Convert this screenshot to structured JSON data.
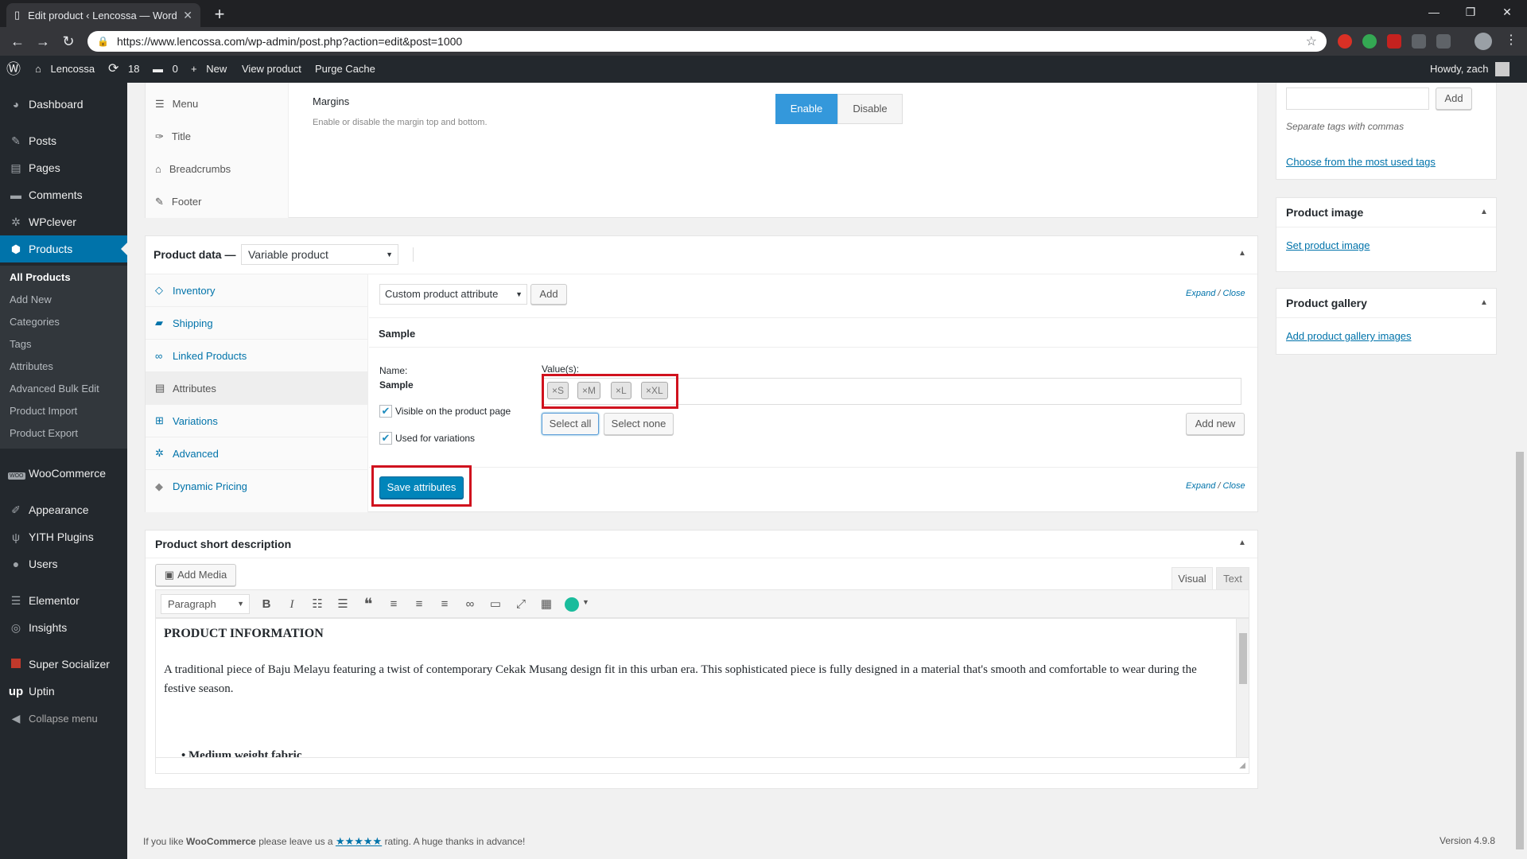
{
  "browser": {
    "tab_title": "Edit product ‹ Lencossa — Word",
    "url": "https://www.lencossa.com/wp-admin/post.php?action=edit&post=1000"
  },
  "adminbar": {
    "site_name": "Lencossa",
    "updates_count": "18",
    "comments_count": "0",
    "new_label": "New",
    "view_product": "View product",
    "purge_cache": "Purge Cache",
    "howdy": "Howdy, zach"
  },
  "sidebar": {
    "items": [
      {
        "label": "Dashboard"
      },
      {
        "label": "Posts"
      },
      {
        "label": "Pages"
      },
      {
        "label": "Comments"
      },
      {
        "label": "WPclever"
      },
      {
        "label": "Products"
      },
      {
        "label": "WooCommerce"
      },
      {
        "label": "Appearance"
      },
      {
        "label": "YITH Plugins"
      },
      {
        "label": "Users"
      },
      {
        "label": "Elementor"
      },
      {
        "label": "Insights"
      },
      {
        "label": "Super Socializer"
      },
      {
        "label": "Uptin"
      },
      {
        "label": "Collapse menu"
      }
    ],
    "submenu": [
      "All Products",
      "Add New",
      "Categories",
      "Tags",
      "Attributes",
      "Advanced Bulk Edit",
      "Product Import",
      "Product Export"
    ],
    "woo_badge": "WOO",
    "uptin_logo": "up"
  },
  "options_panel": {
    "tabs": [
      "Menu",
      "Title",
      "Breadcrumbs",
      "Footer"
    ],
    "margins_title": "Margins",
    "margins_desc": "Enable or disable the margin top and bottom.",
    "enable_label": "Enable",
    "disable_label": "Disable"
  },
  "product_data": {
    "label": "Product data —",
    "type_selected": "Variable product",
    "tabs": [
      "Inventory",
      "Shipping",
      "Linked Products",
      "Attributes",
      "Variations",
      "Advanced",
      "Dynamic Pricing"
    ],
    "attribute_select": "Custom product attribute",
    "add_label": "Add",
    "expand_close": [
      "Expand",
      "/",
      "Close"
    ],
    "attribute_name_heading": "Sample",
    "name_label": "Name:",
    "name_value": "Sample",
    "values_label": "Value(s):",
    "tokens": [
      "S",
      "M",
      "L",
      "XL"
    ],
    "visible_label": "Visible on the product page",
    "variations_label": "Used for variations",
    "select_all": "Select all",
    "select_none": "Select none",
    "add_new": "Add new",
    "save_attributes": "Save attributes"
  },
  "short_desc": {
    "title": "Product short description",
    "add_media": "Add Media",
    "tab_visual": "Visual",
    "tab_text": "Text",
    "format_select": "Paragraph",
    "heading": "PRODUCT INFORMATION",
    "paragraph": "A traditional piece of Baju Melayu featuring a twist of contemporary Cekak Musang design fit in this urban era. This sophisticated piece is fully designed in a material that's smooth and comfortable to wear during the festive season.",
    "cut_bullet": "Medium weight fabric"
  },
  "right_col": {
    "add_label": "Add",
    "tags_hint": "Separate tags with commas",
    "most_used": "Choose from the most used tags",
    "product_image_title": "Product image",
    "set_image": "Set product image",
    "gallery_title": "Product gallery",
    "add_gallery": "Add product gallery images"
  },
  "footer": {
    "thanks_prefix": "If you like",
    "brand": "WooCommerce",
    "thanks_mid": "please leave us a",
    "stars": "★★★★★",
    "thanks_suffix": "rating. A huge thanks in advance!",
    "version": "Version 4.9.8"
  },
  "colors": {
    "wp_blue": "#0073aa",
    "primary_button": "#0085ba",
    "sidebar_bg": "#23282d",
    "highlight_red": "#d0121e"
  }
}
